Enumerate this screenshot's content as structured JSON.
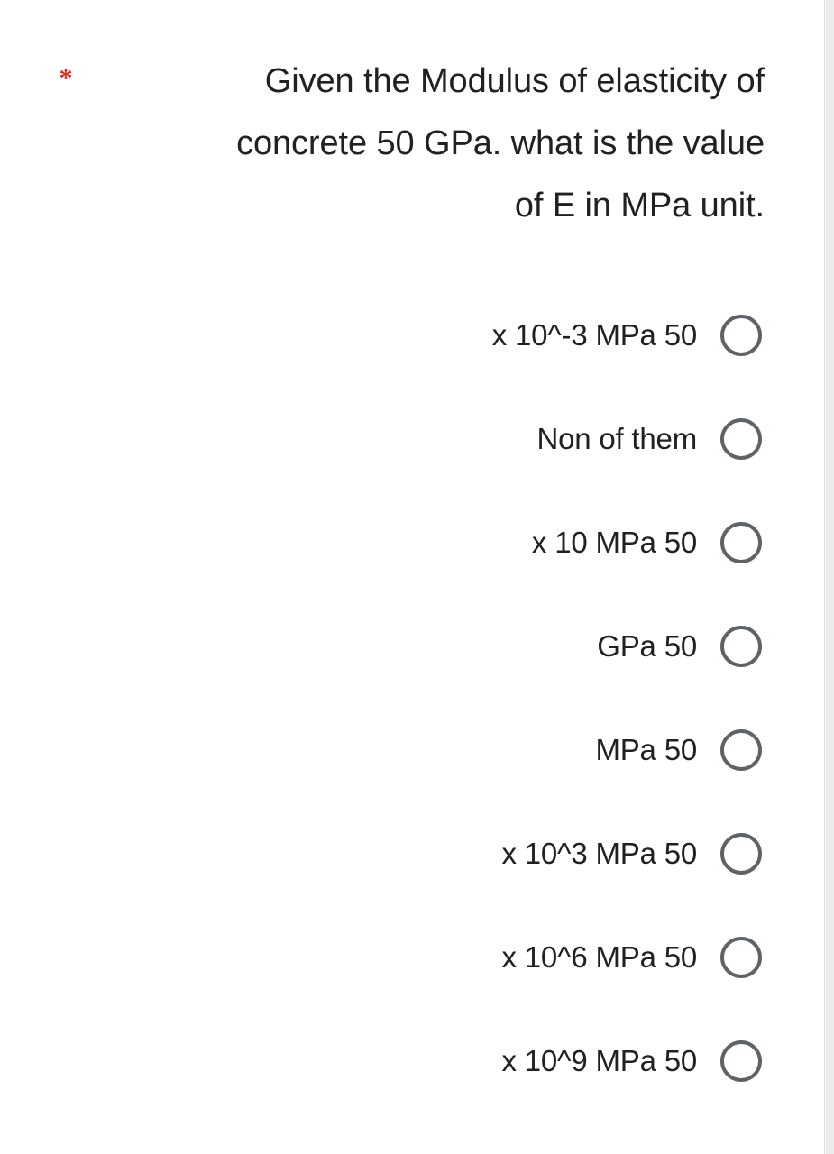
{
  "form": {
    "required_marker": "*",
    "question": {
      "lines": [
        "Given the Modulus of elasticity of",
        "concrete 50 GPa. what is the value",
        ".of E in MPa unit"
      ],
      "full_text": "Given the Modulus of elasticity of\nconcrete 50 GPa. what is the value\n.of E in MPa unit"
    },
    "options": [
      {
        "label": "50 x 10^-3 MPa",
        "selected": false,
        "icon": "radio-unchecked-icon"
      },
      {
        "label": "Non of them",
        "selected": false,
        "icon": "radio-unchecked-icon"
      },
      {
        "label": "50 x 10 MPa",
        "selected": false,
        "icon": "radio-unchecked-icon"
      },
      {
        "label": "50 GPa",
        "selected": false,
        "icon": "radio-unchecked-icon"
      },
      {
        "label": "50 MPa",
        "selected": false,
        "icon": "radio-unchecked-icon"
      },
      {
        "label": "50 x 10^3 MPa",
        "selected": false,
        "icon": "radio-unchecked-icon"
      },
      {
        "label": "50 x 10^6 MPa",
        "selected": false,
        "icon": "radio-unchecked-icon"
      },
      {
        "label": "50 x 10^9 MPa",
        "selected": false,
        "icon": "radio-unchecked-icon"
      }
    ]
  },
  "colors": {
    "required_red": "#d93025",
    "text_primary": "#202124",
    "radio_stroke": "#5f6368",
    "card_background": "#ffffff",
    "page_background": "#ebedeb",
    "card_border": "#dfe1e1"
  }
}
